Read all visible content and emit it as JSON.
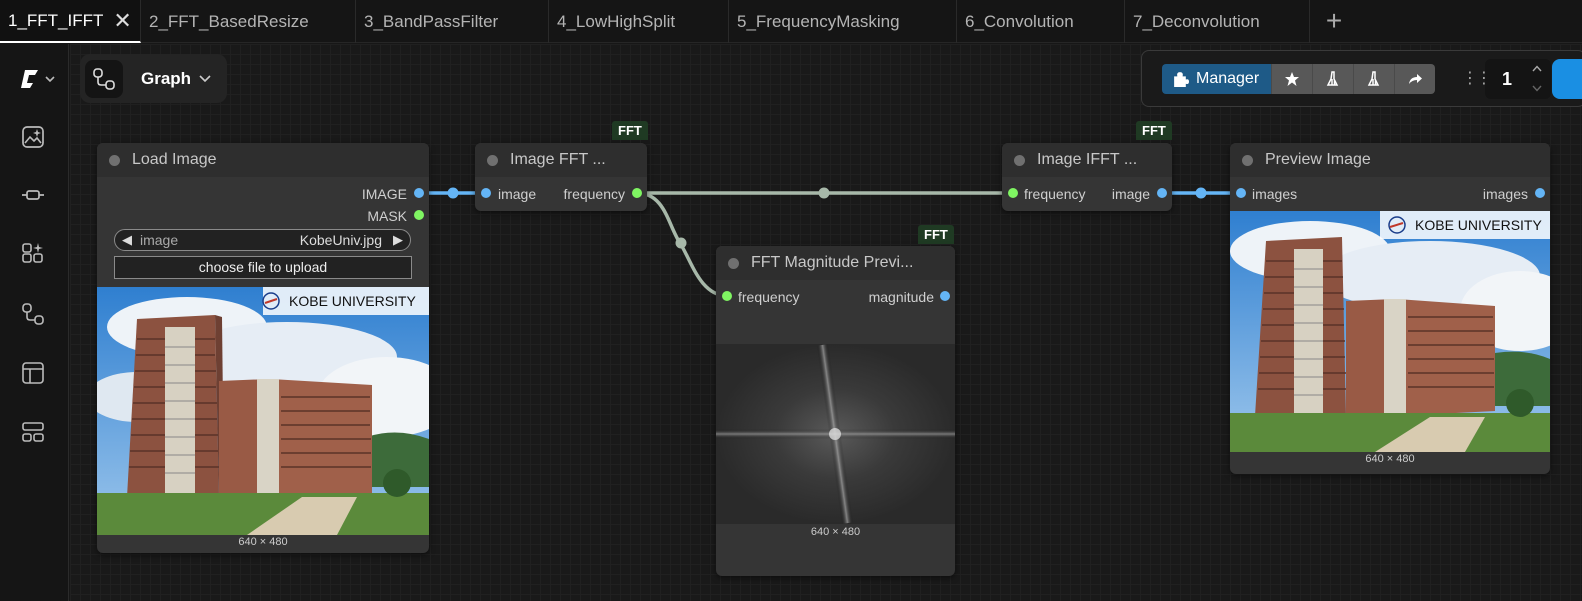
{
  "tabs": [
    {
      "label": "1_FFT_IFFT",
      "active": true,
      "close": "✕"
    },
    {
      "label": "2_FFT_BasedResize"
    },
    {
      "label": "3_BandPassFilter"
    },
    {
      "label": "4_LowHighSplit"
    },
    {
      "label": "5_FrequencyMasking"
    },
    {
      "label": "6_Convolution"
    },
    {
      "label": "7_Deconvolution"
    }
  ],
  "add_tab": "+",
  "graph_menu": {
    "label": "Graph"
  },
  "toolbar": {
    "manager_label": "Manager",
    "queue_count": "1"
  },
  "colors": {
    "accent": "#1a8fe3",
    "manager": "#1e5a87",
    "image_wire": "#64b5f6",
    "frequency_wire": "#a7b8a9",
    "frequency_pin": "#7ff562"
  },
  "nodes": {
    "load_image": {
      "title": "Load Image",
      "outputs": [
        "IMAGE",
        "MASK"
      ],
      "image_widget_label": "image",
      "image_widget_value": "KobeUniv.jpg",
      "upload_label": "choose file to upload",
      "preview_logo": "KOBE UNIVERSITY",
      "caption": "640 × 480"
    },
    "image_fft": {
      "badge": "FFT",
      "title": "Image FFT ...",
      "input": "image",
      "output": "frequency"
    },
    "fft_magnitude": {
      "badge": "FFT",
      "title": "FFT Magnitude Previ...",
      "input": "frequency",
      "output": "magnitude",
      "caption": "640 × 480"
    },
    "image_ifft": {
      "badge": "FFT",
      "title": "Image IFFT ...",
      "input": "frequency",
      "output": "image"
    },
    "preview_image": {
      "title": "Preview Image",
      "input": "images",
      "output": "images",
      "preview_logo": "KOBE UNIVERSITY",
      "caption": "640 × 480"
    }
  }
}
